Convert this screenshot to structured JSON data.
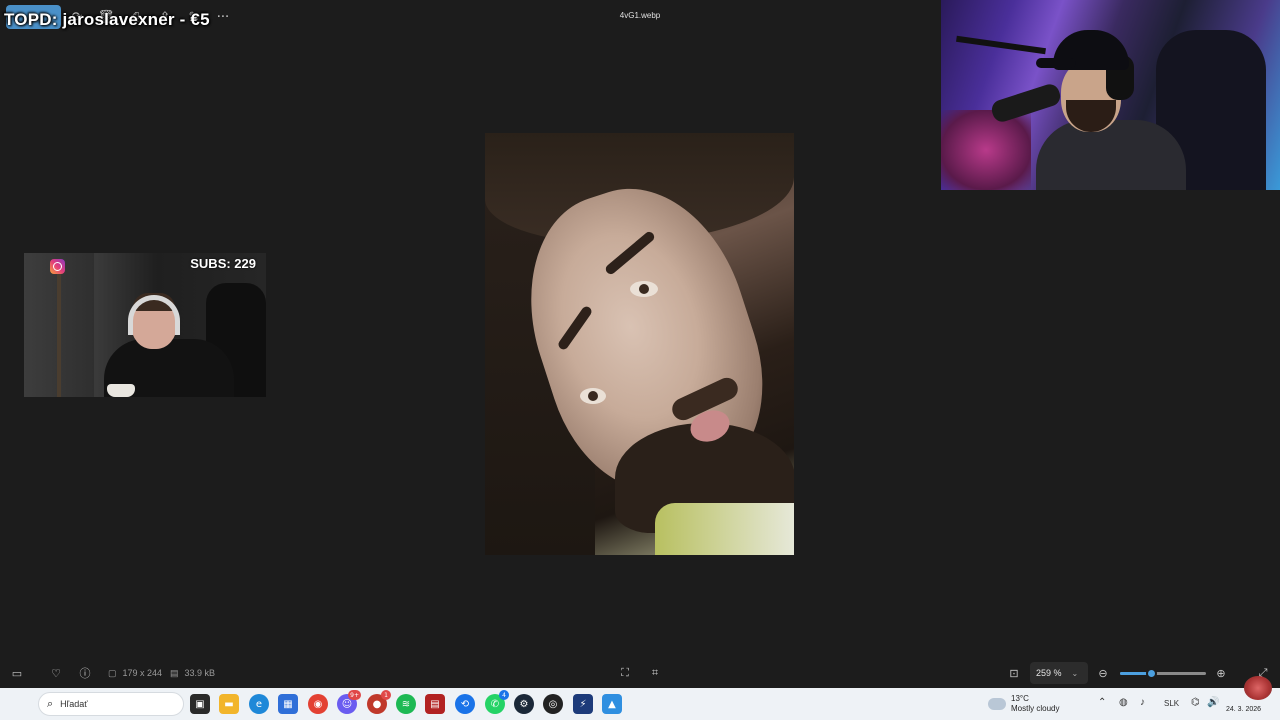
{
  "viewer": {
    "filename": "4vG1.webp",
    "more_glyph": "···",
    "image_dims": "179 x 244",
    "file_size": "33.9 kB",
    "zoom": "259 %"
  },
  "overlay": {
    "topd": "TOPD: jaroslavexner - €5",
    "subs": "SUBS: 229"
  },
  "zoom_slider": {
    "level_fraction": 0.36
  },
  "taskbar": {
    "search_placeholder": "Hľadať",
    "weather_temp": "13°C",
    "weather_desc": "Mostly cloudy",
    "lang": "SLK",
    "date": "24. 3. 2026",
    "discord_badge": "9+",
    "app_badge": "1",
    "whatsapp_badge": "4"
  },
  "colors": {
    "accent": "#4ca0e0",
    "viewer_bg": "#1c1c1c",
    "taskbar_bg": "#eef2f6"
  }
}
